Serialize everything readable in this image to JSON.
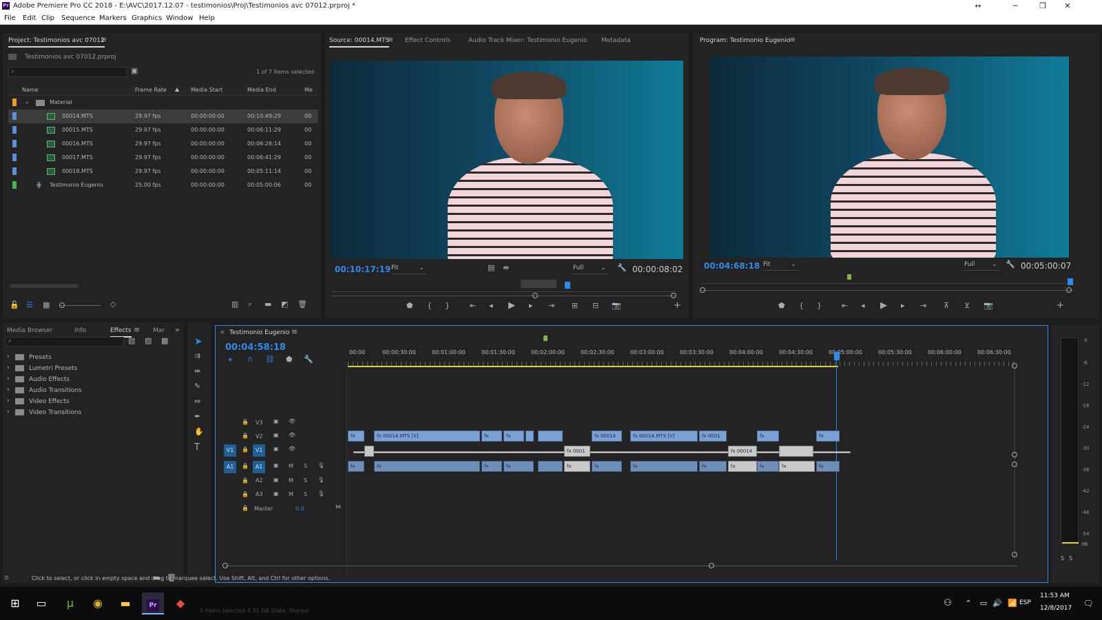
{
  "window": {
    "title": "Adobe Premiere Pro CC 2018 - E:\\AVC\\2017.12.07 - testimonios\\Proj\\Testimonios avc 07012.prproj *",
    "app_badge": "Pr"
  },
  "menu": [
    "File",
    "Edit",
    "Clip",
    "Sequence",
    "Markers",
    "Graphics",
    "Window",
    "Help"
  ],
  "project": {
    "panel_title": "Project: Testimonios avc 07012",
    "file_name": "Testimonios avc 07012.prproj",
    "selection_info": "1 of 7 items selected",
    "columns": [
      "Name",
      "Frame Rate",
      "Media Start",
      "Media End",
      "Me"
    ],
    "folder": "Material",
    "items": [
      {
        "name": "00014.MTS",
        "rate": "29.97 fps",
        "start": "00:00:00:00",
        "end": "00:10:49:29",
        "extra": "00"
      },
      {
        "name": "00015.MTS",
        "rate": "29.97 fps",
        "start": "00:00:00:00",
        "end": "00:06:11:29",
        "extra": "00"
      },
      {
        "name": "00016.MTS",
        "rate": "29.97 fps",
        "start": "00:00:00:00",
        "end": "00:06:26:14",
        "extra": "00"
      },
      {
        "name": "00017.MTS",
        "rate": "29.97 fps",
        "start": "00:00:00:00",
        "end": "00:06:41:29",
        "extra": "00"
      },
      {
        "name": "00018.MTS",
        "rate": "29.97 fps",
        "start": "00:00:00:00",
        "end": "00:05:11:14",
        "extra": "00"
      },
      {
        "name": "Testimonio Eugenio",
        "rate": "25.00 fps",
        "start": "00:00:00:00",
        "end": "00:05:00:06",
        "extra": "00"
      }
    ]
  },
  "source": {
    "tabs": [
      "Source: 00014.MTS",
      "Effect Controls",
      "Audio Track Mixer: Testimonio Eugenio",
      "Metadata"
    ],
    "timecode": "00:10:17:19",
    "fit": "Fit",
    "quality": "Full",
    "duration": "00:00:08:02"
  },
  "program": {
    "title": "Program: Testimonio Eugenio",
    "timecode": "00:04:68:18",
    "fit": "Fit",
    "quality": "Full",
    "duration": "00:05:00:07"
  },
  "effects": {
    "tabs": [
      "Media Browser",
      "Info",
      "Effects",
      "Mar"
    ],
    "items": [
      "Presets",
      "Lumetri Presets",
      "Audio Effects",
      "Audio Transitions",
      "Video Effects",
      "Video Transitions"
    ]
  },
  "timeline": {
    "sequence": "Testimonio Eugenio",
    "timecode": "00:04:58:18",
    "ruler": [
      "00:00",
      "00:00:30:00",
      "00:01:00:00",
      "00:01:30:00",
      "00:02:00:00",
      "00:02:30:00",
      "00:03:00:00",
      "00:03:30:00",
      "00:04:00:00",
      "00:04:30:00",
      "00:05:00:00",
      "00:05:30:00",
      "00:06:00:00",
      "00:06:30:00"
    ],
    "video_tracks": [
      "V3",
      "V2",
      "V1"
    ],
    "audio_tracks": [
      "A1",
      "A2",
      "A3"
    ],
    "source_target_v": "V1",
    "source_target_a": "A1",
    "mute": "M",
    "solo": "S",
    "master_label": "Master",
    "master_value": "0.0",
    "clip_labels": {
      "main": "00014.MTS [V]",
      "second": "00014.MTS [V]",
      "short": "00014",
      "short2": "0001",
      "fx": "fx"
    }
  },
  "meter": {
    "labels": [
      "0",
      "-6",
      "-12",
      "-18",
      "-24",
      "-30",
      "-36",
      "-42",
      "-48",
      "-54",
      "dB"
    ],
    "solo_buttons": [
      "S",
      "S"
    ]
  },
  "status": {
    "text": "Click to select, or click in empty space and drag to marquee select. Use Shift, Alt, and Ctrl for other options."
  },
  "taskbar": {
    "language": "ESP",
    "time": "11:53 AM",
    "date": "12/8/2017",
    "ghost_text": "5 items selected  4.91 GB      State: Shared"
  }
}
